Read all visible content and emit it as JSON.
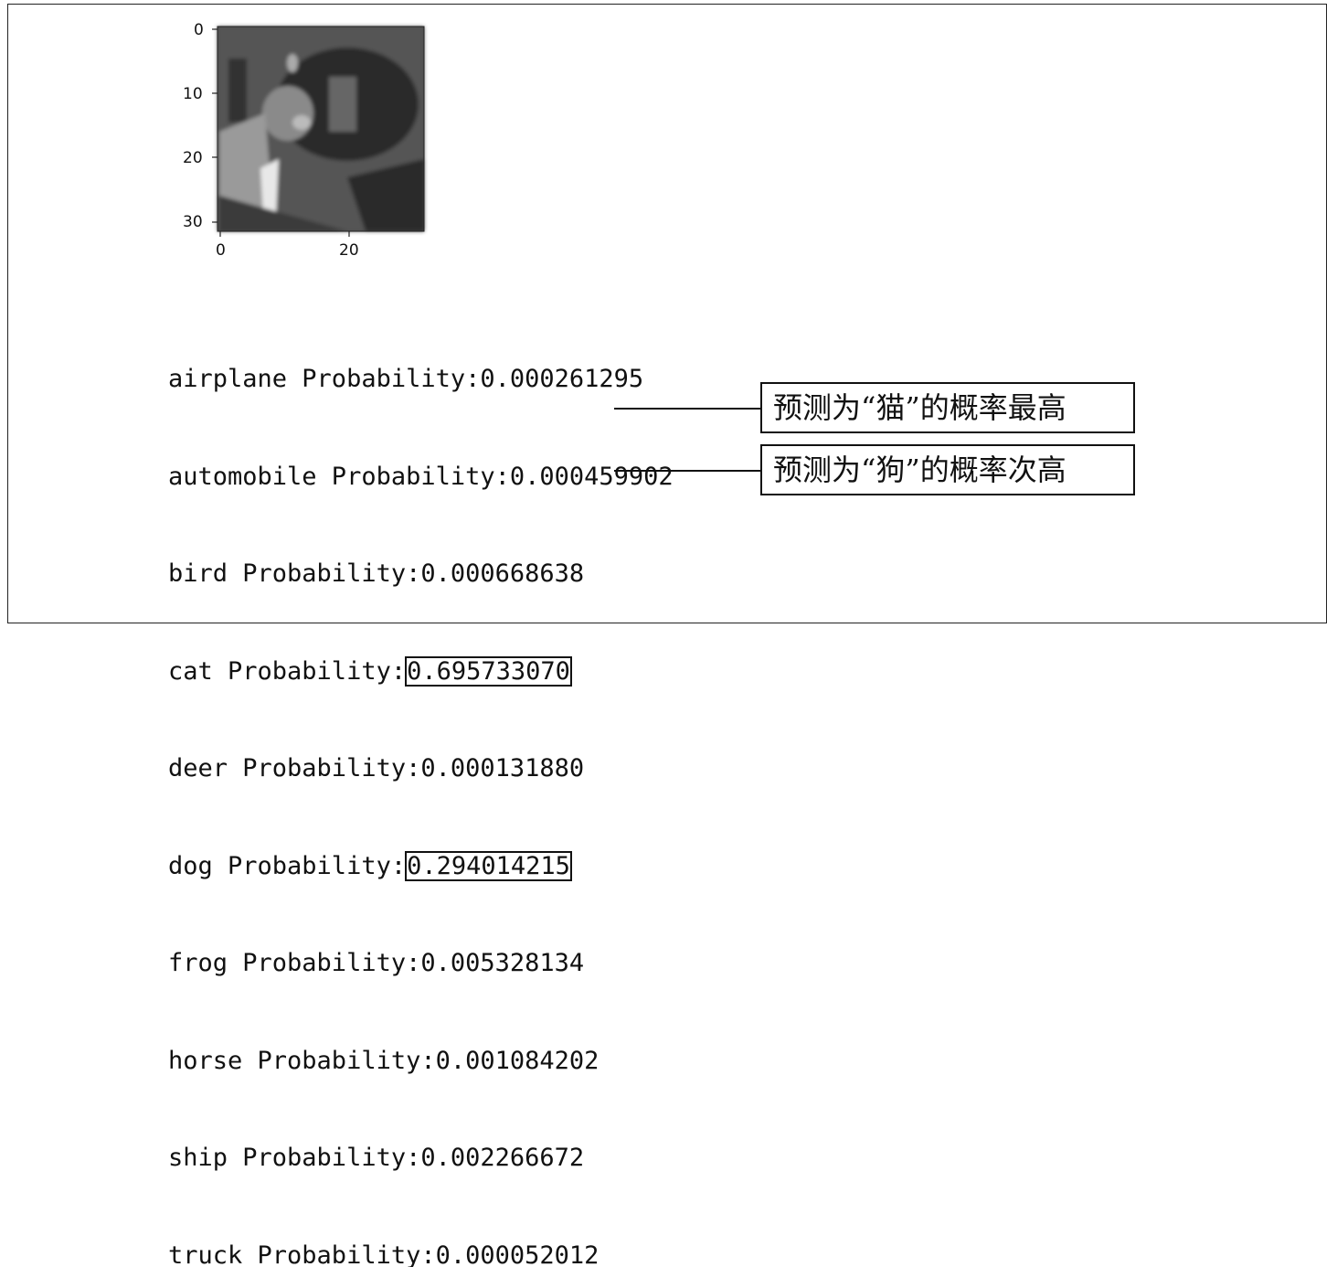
{
  "plot": {
    "y_ticks": [
      "0",
      "10",
      "20",
      "30"
    ],
    "x_ticks": [
      "0",
      "20"
    ]
  },
  "predictions": [
    {
      "label": "airplane Probability:",
      "value": "0.000261295"
    },
    {
      "label": "automobile Probability:",
      "value": "0.000459902"
    },
    {
      "label": "bird Probability:",
      "value": "0.000668638"
    },
    {
      "label": "cat Probability:",
      "value": "0.695733070"
    },
    {
      "label": "deer Probability:",
      "value": "0.000131880"
    },
    {
      "label": "dog Probability:",
      "value": "0.294014215"
    },
    {
      "label": "frog Probability:",
      "value": "0.005328134"
    },
    {
      "label": "horse Probability:",
      "value": "0.001084202"
    },
    {
      "label": "ship Probability:",
      "value": "0.002266672"
    },
    {
      "label": "truck Probability:",
      "value": "0.000052012"
    }
  ],
  "annotations": {
    "cat": "预测为“猫”的概率最高",
    "dog": "预测为“狗”的概率次高"
  }
}
